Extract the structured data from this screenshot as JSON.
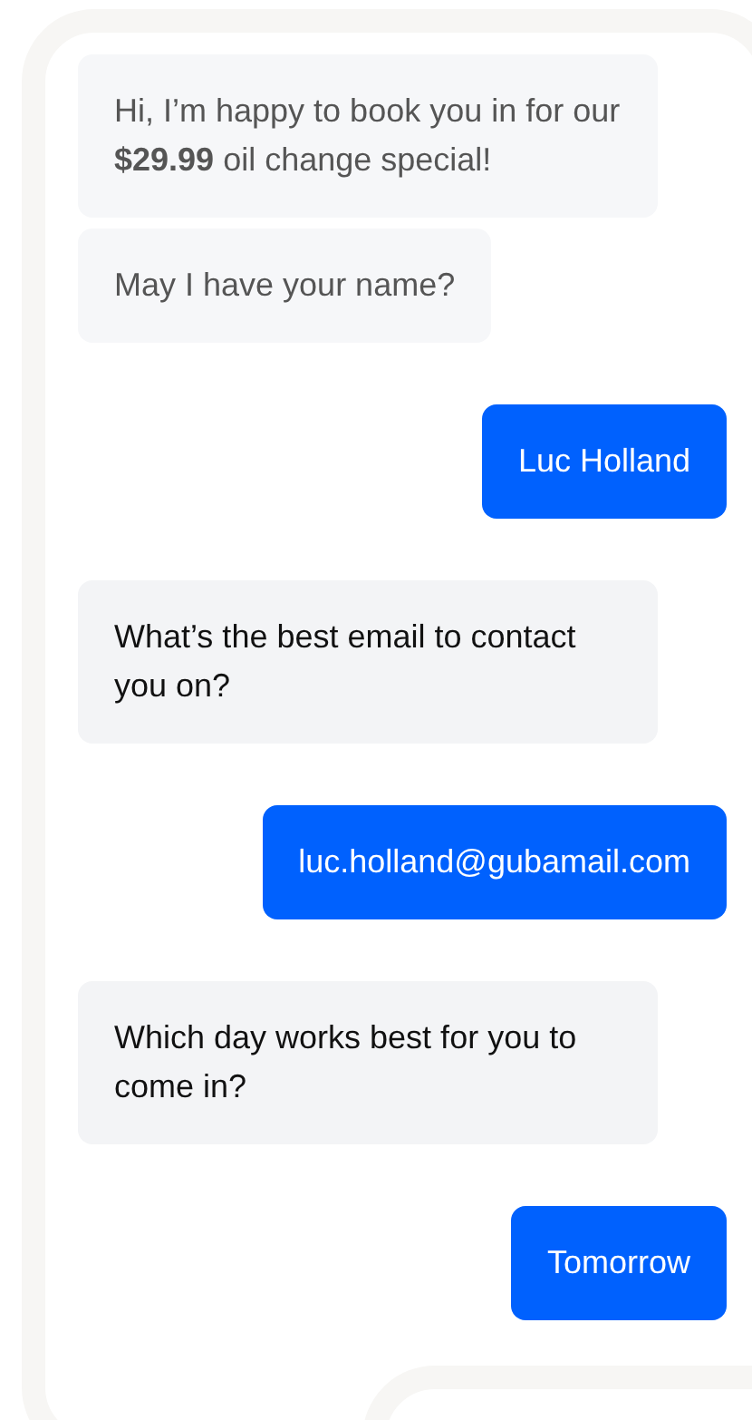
{
  "messages": [
    {
      "kind": "bot",
      "faded": true,
      "text": "Hi, I’m happy to book you in for our **$29.99** oil change special!"
    },
    {
      "kind": "bot",
      "faded": true,
      "text": "May I have your name?"
    },
    {
      "kind": "user",
      "faded": false,
      "text": "Luc Holland"
    },
    {
      "kind": "bot",
      "faded": false,
      "text": "What’s the best email to contact you on?"
    },
    {
      "kind": "user",
      "faded": false,
      "text": "luc.holland@gubamail.com"
    },
    {
      "kind": "bot",
      "faded": false,
      "text": "Which day works best for you to come in?"
    },
    {
      "kind": "user",
      "faded": false,
      "text": "Tomorrow"
    }
  ]
}
